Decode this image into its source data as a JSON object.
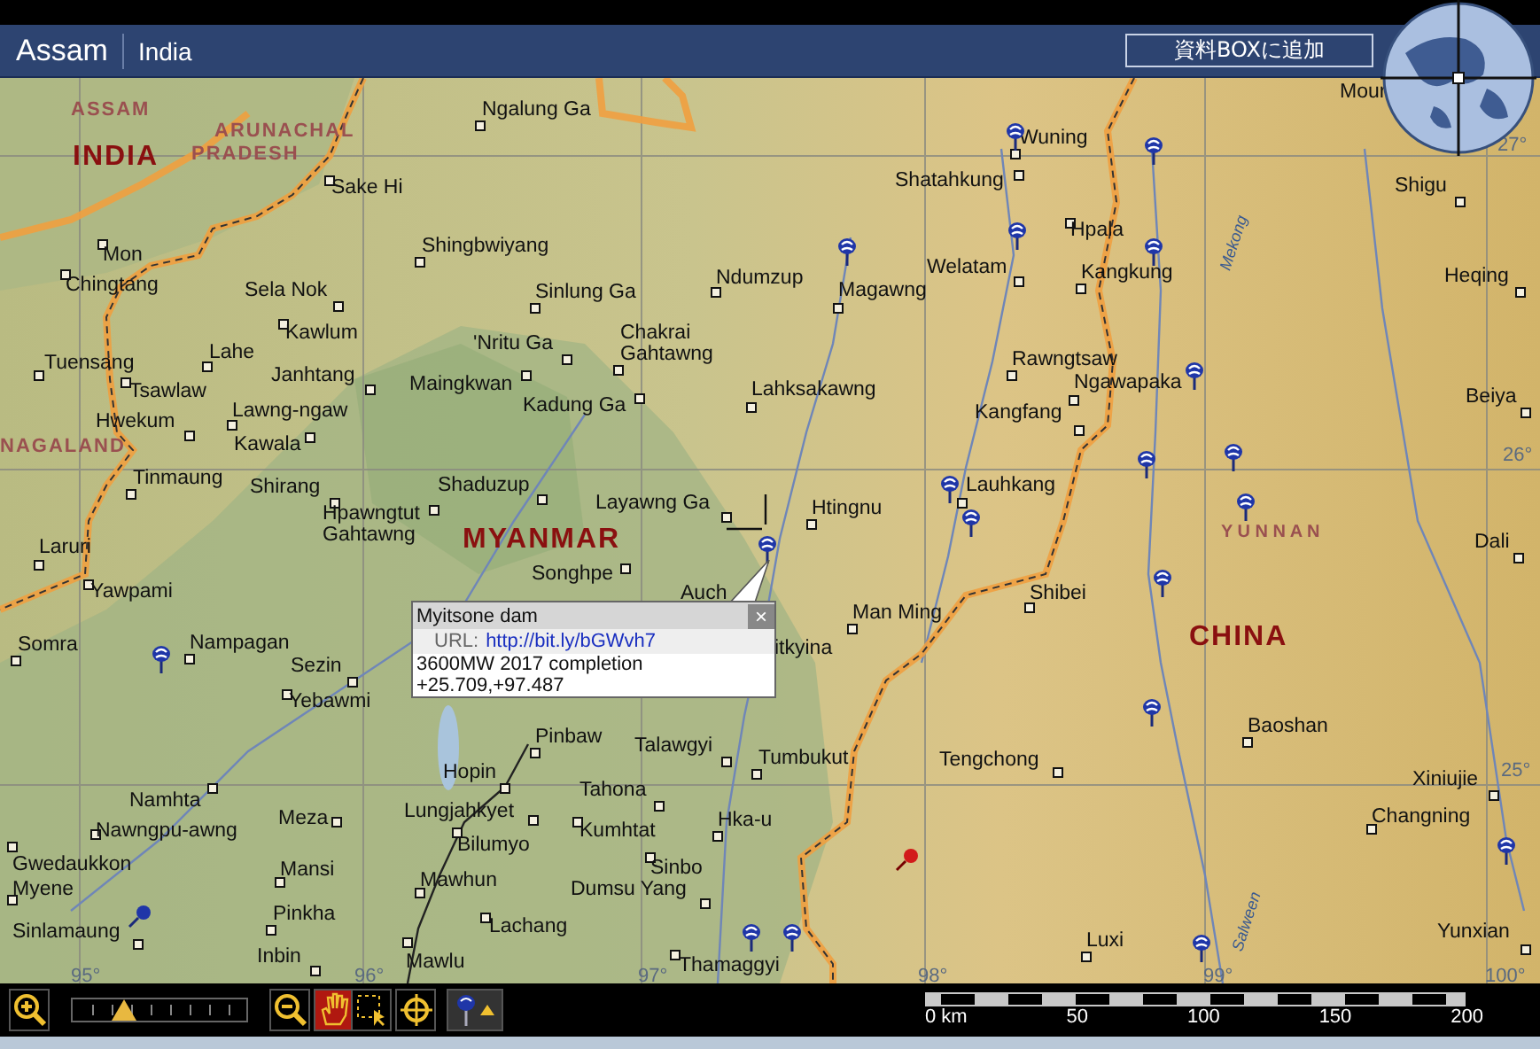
{
  "header": {
    "title": "Assam",
    "subtitle": "India",
    "add_button": "資料BOXに追加"
  },
  "map": {
    "regions": [
      {
        "name": "ASSAM",
        "kind": "state"
      },
      {
        "name": "INDIA",
        "kind": "country"
      },
      {
        "name": "ARUNACHAL",
        "kind": "state"
      },
      {
        "name": "PRADESH",
        "kind": "state"
      },
      {
        "name": "NAGALAND",
        "kind": "state"
      },
      {
        "name": "MYANMAR",
        "kind": "country"
      },
      {
        "name": "CHINA",
        "kind": "country"
      },
      {
        "name": "Y U N N A N",
        "kind": "province"
      }
    ],
    "places": [
      {
        "name": "Ngalung Ga"
      },
      {
        "name": "Sake Hi"
      },
      {
        "name": "Shingbwiyang"
      },
      {
        "name": "Mon"
      },
      {
        "name": "Chingtang"
      },
      {
        "name": "Sela Nok"
      },
      {
        "name": "Kawlum"
      },
      {
        "name": "Lahe"
      },
      {
        "name": "Tuensang"
      },
      {
        "name": "Tsawlaw"
      },
      {
        "name": "Janhtang"
      },
      {
        "name": "'Nritu Ga"
      },
      {
        "name": "Maingkwan"
      },
      {
        "name": "Hwekum"
      },
      {
        "name": "Lawng-ngaw"
      },
      {
        "name": "Kawala"
      },
      {
        "name": "Tinmaung"
      },
      {
        "name": "Shirang"
      },
      {
        "name": "Shaduzup"
      },
      {
        "name": "Hpawngtut Gahtawng"
      },
      {
        "name": "Sinlung Ga"
      },
      {
        "name": "Chakrai Gahtawng"
      },
      {
        "name": "Kadung Ga"
      },
      {
        "name": "Ndumzup"
      },
      {
        "name": "Magawng"
      },
      {
        "name": "Lahksakawng"
      },
      {
        "name": "Layawng Ga"
      },
      {
        "name": "Htingnu"
      },
      {
        "name": "Wuning"
      },
      {
        "name": "Shatahkung"
      },
      {
        "name": "Welatam"
      },
      {
        "name": "Hpala"
      },
      {
        "name": "Kangkung"
      },
      {
        "name": "Rawngtsaw"
      },
      {
        "name": "Ngawapaka"
      },
      {
        "name": "Kangfang"
      },
      {
        "name": "Lauhkang"
      },
      {
        "name": "Shigu"
      },
      {
        "name": "Heqing"
      },
      {
        "name": "Beiya"
      },
      {
        "name": "Laruri"
      },
      {
        "name": "Dali"
      },
      {
        "name": "Yawpami"
      },
      {
        "name": "Somra"
      },
      {
        "name": "Nampagan"
      },
      {
        "name": "Sezin"
      },
      {
        "name": "Yebawmi"
      },
      {
        "name": "Songhpe"
      },
      {
        "name": "Auch"
      },
      {
        "name": "Man Ming"
      },
      {
        "name": "itkyina"
      },
      {
        "name": "Pinbaw"
      },
      {
        "name": "Talawgyi"
      },
      {
        "name": "Tumbukut"
      },
      {
        "name": "Tengchong"
      },
      {
        "name": "Hopin"
      },
      {
        "name": "Lungjahkyet"
      },
      {
        "name": "Bilumyo"
      },
      {
        "name": "Tahona"
      },
      {
        "name": "Kumhtat"
      },
      {
        "name": "Hka-u"
      },
      {
        "name": "Sinbo"
      },
      {
        "name": "Dumsu Yang"
      },
      {
        "name": "Lachang"
      },
      {
        "name": "Mawhun"
      },
      {
        "name": "Mawlu"
      },
      {
        "name": "Thamaggyi"
      },
      {
        "name": "Namhta"
      },
      {
        "name": "Nawngpu-awng"
      },
      {
        "name": "Meza"
      },
      {
        "name": "Mansi"
      },
      {
        "name": "Pinkha"
      },
      {
        "name": "Inbin"
      },
      {
        "name": "Gwedaukkon"
      },
      {
        "name": "Myene"
      },
      {
        "name": "Sinlamaung"
      },
      {
        "name": "Shibei"
      },
      {
        "name": "Baoshan"
      },
      {
        "name": "Xiniujie"
      },
      {
        "name": "Changning"
      },
      {
        "name": "Luxi"
      },
      {
        "name": "Yunxian"
      },
      {
        "name": "Mour"
      }
    ],
    "graticule": [
      {
        "label": "27°"
      },
      {
        "label": "26°"
      },
      {
        "label": "25°"
      },
      {
        "label": "95°"
      },
      {
        "label": "96°"
      },
      {
        "label": "97°"
      },
      {
        "label": "98°"
      },
      {
        "label": "99°"
      },
      {
        "label": "100°"
      }
    ],
    "rivers": [
      {
        "name": "Mekong"
      },
      {
        "name": "Salween"
      }
    ]
  },
  "popup": {
    "title": "Myitsone dam",
    "close": "×",
    "url_label": "URL:",
    "url": "http://bit.ly/bGWvh7",
    "lines": [
      "3600MW 2017 completion",
      "+25.709,+97.487"
    ]
  },
  "toolbar": {
    "zoom": {
      "level": 0.3
    },
    "tools": [
      {
        "kind": "hand",
        "selected": true
      },
      {
        "kind": "select",
        "selected": false
      }
    ]
  },
  "scale": {
    "labels": [
      "0 km",
      "50",
      "100",
      "150",
      "200"
    ]
  }
}
